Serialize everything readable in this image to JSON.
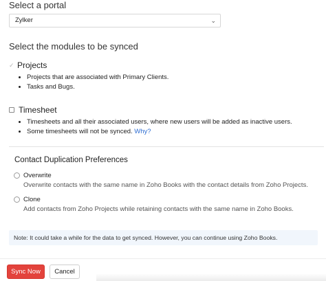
{
  "portal": {
    "title": "Select a portal",
    "selected": "Zylker"
  },
  "modules": {
    "title": "Select the modules to be synced",
    "projects": {
      "label": "Projects",
      "bullets": [
        "Projects that are associated with Primary Clients.",
        "Tasks and Bugs."
      ]
    },
    "timesheet": {
      "label": "Timesheet",
      "bullet1": "Timesheets and all their associated users, where new users will be added as inactive users.",
      "bullet2_text": "Some timesheets will not be synced.",
      "bullet2_link": "Why?"
    }
  },
  "preferences": {
    "title": "Contact Duplication Preferences",
    "overwrite": {
      "label": "Overwrite",
      "description": "Overwrite contacts with the same name in Zoho Books with the contact details from Zoho Projects."
    },
    "clone": {
      "label": "Clone",
      "description": "Add contacts from Zoho Projects while retaining contacts with the same name in Zoho Books."
    }
  },
  "note": "Note: It could take a while for the data to get synced. However, you can continue using Zoho Books.",
  "actions": {
    "primary": "Sync Now",
    "secondary": "Cancel"
  },
  "colors": {
    "primary_button": "#e3433c",
    "link": "#2d6dd2",
    "note_background": "#f1f6fc"
  }
}
